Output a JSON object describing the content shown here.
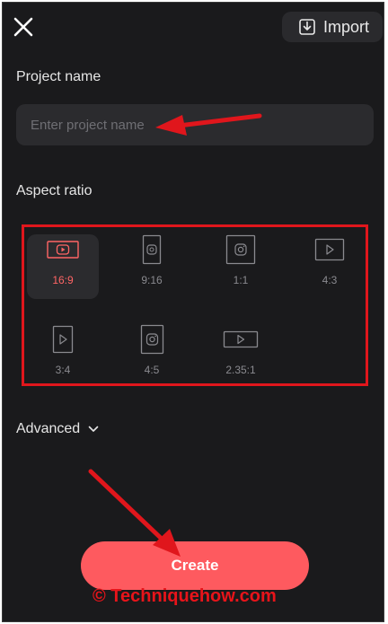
{
  "header": {
    "close_icon": "close-icon",
    "import_icon": "import-icon",
    "import_label": "Import"
  },
  "project": {
    "label": "Project name",
    "placeholder": "Enter project name",
    "value": ""
  },
  "aspect": {
    "label": "Aspect ratio",
    "selected": "16:9",
    "options": [
      {
        "label": "16:9",
        "icon": "youtube-icon"
      },
      {
        "label": "9:16",
        "icon": "tiktok-icon"
      },
      {
        "label": "1:1",
        "icon": "instagram-icon"
      },
      {
        "label": "4:3",
        "icon": "play-icon"
      },
      {
        "label": "3:4",
        "icon": "play-icon"
      },
      {
        "label": "4:5",
        "icon": "instagram-icon"
      },
      {
        "label": "2.35:1",
        "icon": "play-icon"
      }
    ]
  },
  "advanced": {
    "label": "Advanced",
    "icon": "chevron-down-icon"
  },
  "create": {
    "label": "Create"
  },
  "watermark": {
    "text": "© Techniquehow.com"
  },
  "colors": {
    "background": "#1a1a1c",
    "accent": "#fe5a5f",
    "selected_text": "#ff6565",
    "annotation": "#e0161c"
  }
}
